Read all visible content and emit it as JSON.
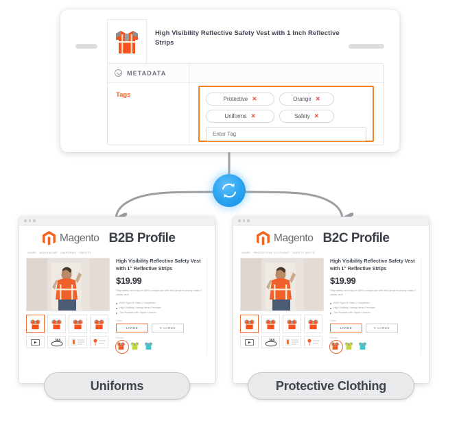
{
  "pim_card": {
    "product_title": "High Visibility Reflective Safety Vest with 1 Inch Reflective Strips",
    "thumbnail_icon": "safety-vest-icon",
    "metadata_section": {
      "toggle_icon": "chevron-down-circle-icon",
      "label": "METADATA"
    },
    "tags_field": {
      "label": "Tags",
      "chips": [
        {
          "label": "Protective",
          "remove_icon": "close-x-icon"
        },
        {
          "label": "Orange",
          "remove_icon": "close-x-icon"
        },
        {
          "label": "Uniforms",
          "remove_icon": "close-x-icon"
        },
        {
          "label": "Safety",
          "remove_icon": "close-x-icon"
        }
      ],
      "input_placeholder": "Enter Tag",
      "highlight_color": "#f58220"
    }
  },
  "connector": {
    "sync_icon": "sync-refresh-icon",
    "node_color": "#29a3f0",
    "arrow_color": "#9b9fa3"
  },
  "storefronts": [
    {
      "id": "b2b",
      "brand_logo_icon": "magento-logo-icon",
      "brand_name": "Magento",
      "profile_title": "B2B Profile",
      "breadcrumb": "HOME  ·  WORKWEAR  ·  UNIFORMS  ·  SAFETY",
      "product": {
        "title": "High Visibility Reflective Safety Vest with 1\" Reflective Strips",
        "price": "$19.99",
        "description": "Stay safety and stay in ANSI compliance with this great economy class 2 safety vest.",
        "bullets": [
          "ANSI Type R Class 2 Compliant",
          "High Visibility Orange Mesh Provides",
          "Two Pockets with Zipper Closure"
        ],
        "size_label": "Size:",
        "sizes": [
          {
            "label": "LARGE",
            "selected": true
          },
          {
            "label": "X-LARGE",
            "selected": false
          }
        ],
        "color_label": "Color:",
        "colors": [
          {
            "name": "orange",
            "hex": "#f0602b",
            "selected": true
          },
          {
            "name": "lime",
            "hex": "#c6d93a",
            "selected": false
          },
          {
            "name": "teal",
            "hex": "#3fc8cf",
            "selected": false
          }
        ],
        "thumbnails": [
          {
            "icon": "safety-vest-icon",
            "selected": true
          },
          {
            "icon": "safety-vest-icon",
            "selected": false
          },
          {
            "icon": "safety-vest-icon",
            "selected": false
          },
          {
            "icon": "safety-vest-icon",
            "selected": false
          }
        ],
        "media_buttons": [
          {
            "icon": "play-video-icon",
            "label": ""
          },
          {
            "icon": "spin-360-icon",
            "label": "360°"
          },
          {
            "icon": "spec-sheet-icon",
            "label": ""
          },
          {
            "icon": "diagram-icon",
            "label": ""
          }
        ]
      },
      "footer_pill": "Uniforms"
    },
    {
      "id": "b2c",
      "brand_logo_icon": "magento-logo-icon",
      "brand_name": "Magento",
      "profile_title": "B2C Profile",
      "breadcrumb": "HOME  ·  PROTECTIVE CLOTHING  ·  SAFETY VESTS",
      "product": {
        "title": "High Visibility Reflective Safety Vest with 1\" Reflective Strips",
        "price": "$19.99",
        "description": "Stay safety and stay in ANSI compliance with this great economy class 2 safety vest.",
        "bullets": [
          "ANSI Type R Class 2 Compliant",
          "High Visibility Orange Mesh Provides",
          "Two Pockets with Zipper Closure"
        ],
        "size_label": "Size:",
        "sizes": [
          {
            "label": "LARGE",
            "selected": true
          },
          {
            "label": "X-LARGE",
            "selected": false
          }
        ],
        "color_label": "Color:",
        "colors": [
          {
            "name": "orange",
            "hex": "#f0602b",
            "selected": true
          },
          {
            "name": "lime",
            "hex": "#c6d93a",
            "selected": false
          },
          {
            "name": "teal",
            "hex": "#3fc8cf",
            "selected": false
          }
        ],
        "thumbnails": [
          {
            "icon": "safety-vest-icon",
            "selected": true
          },
          {
            "icon": "safety-vest-icon",
            "selected": false
          },
          {
            "icon": "safety-vest-icon",
            "selected": false
          },
          {
            "icon": "safety-vest-icon",
            "selected": false
          }
        ],
        "media_buttons": [
          {
            "icon": "play-video-icon",
            "label": ""
          },
          {
            "icon": "spin-360-icon",
            "label": "360°"
          },
          {
            "icon": "spec-sheet-icon",
            "label": ""
          },
          {
            "icon": "diagram-icon",
            "label": ""
          }
        ]
      },
      "footer_pill": "Protective Clothing"
    }
  ]
}
